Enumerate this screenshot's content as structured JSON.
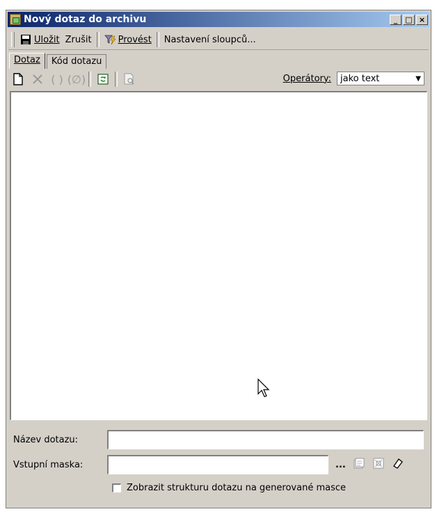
{
  "window": {
    "title": "Nový dotaz do archivu",
    "controls": {
      "minimize": "_",
      "maximize": "□",
      "close": "×"
    }
  },
  "toolbar": {
    "save_label": "Uložit",
    "cancel_label": "Zrušit",
    "execute_label": "Provést",
    "columns_label": "Nastavení sloupců..."
  },
  "tabs": {
    "query": "Dotaz",
    "query_code": "Kód dotazu"
  },
  "operators": {
    "label": "Operátory:",
    "selected": "jako text"
  },
  "form": {
    "query_name_label": "Název dotazu:",
    "query_name_value": "",
    "input_mask_label": "Vstupní maska:",
    "input_mask_value": "",
    "ellipsis_label": "...",
    "show_structure_label": "Zobrazit strukturu dotazu na generované masce"
  },
  "icons": {
    "save": "floppy-disk-icon",
    "execute": "funnel-lightning-icon",
    "new": "new-document-icon",
    "delete": "delete-x-icon",
    "group": "parentheses-icon",
    "ungroup": "crossed-parentheses-icon",
    "refresh": "refresh-icon",
    "preview": "preview-icon",
    "properties": "properties-icon",
    "mask": "mask-icon",
    "eraser": "eraser-icon"
  },
  "colors": {
    "title_start": "#0a246a",
    "title_end": "#a6caf0",
    "face": "#d4d0c8"
  }
}
